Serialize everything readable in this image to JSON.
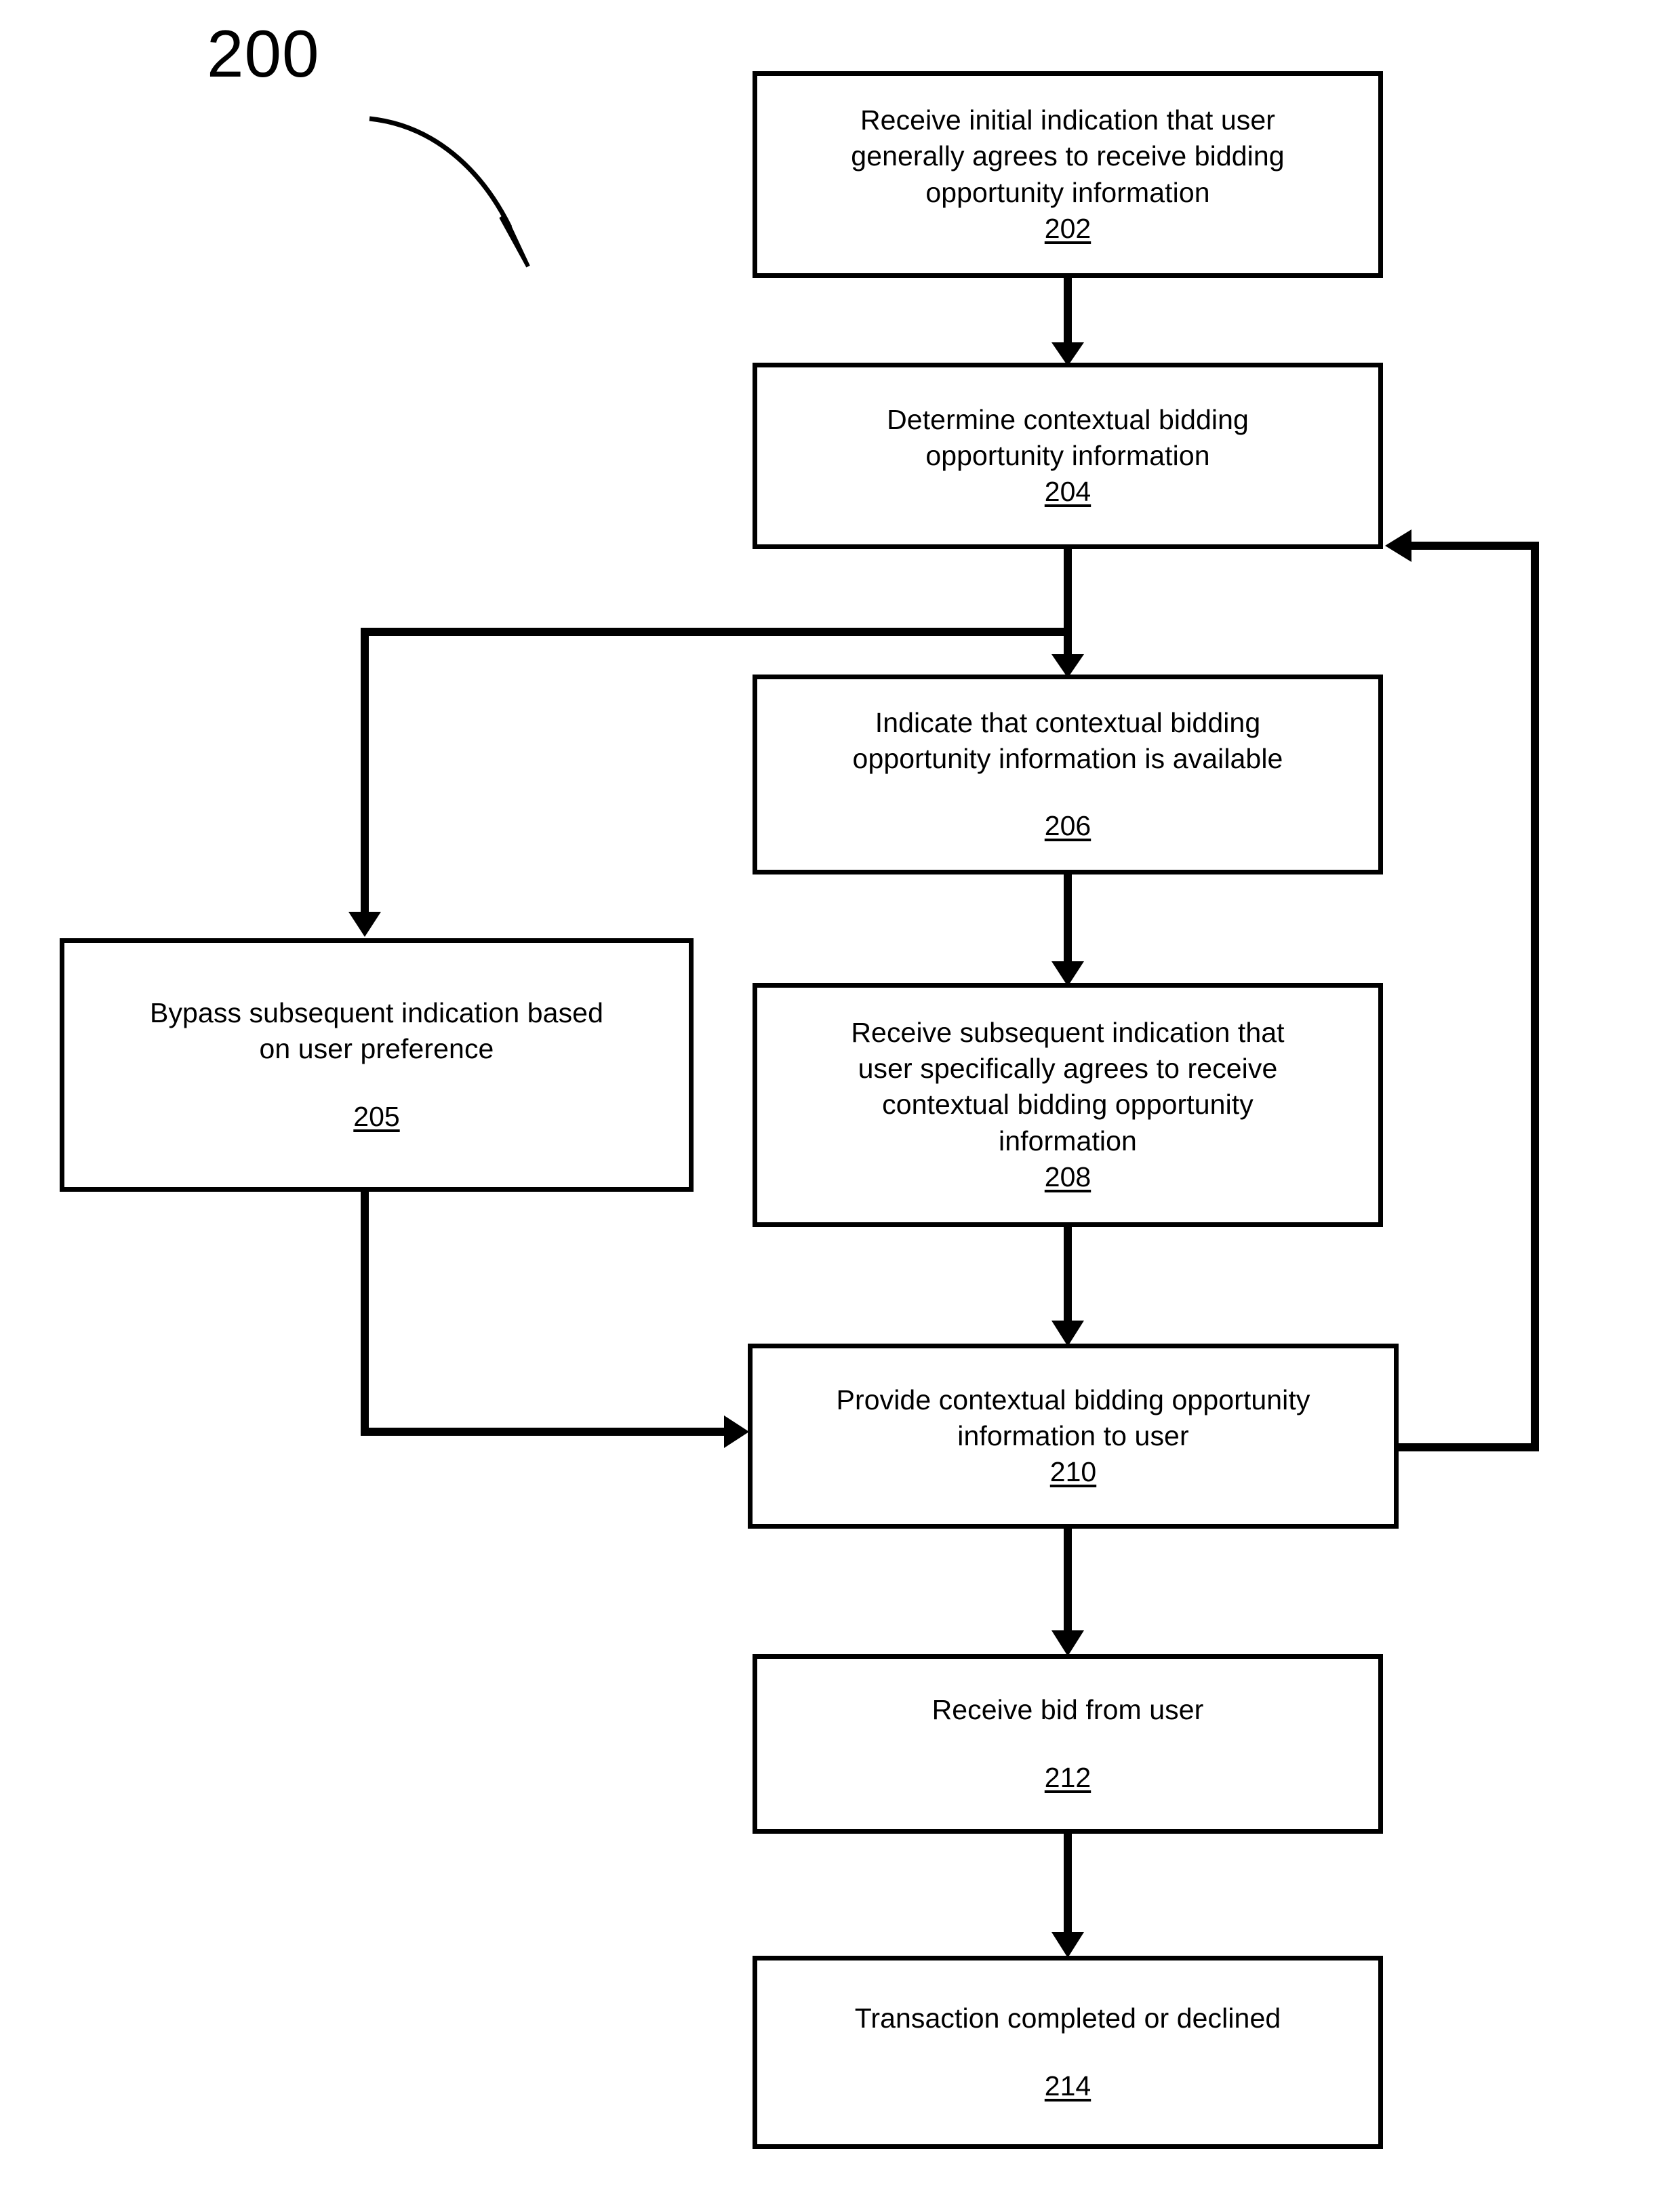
{
  "figure": {
    "number": "200",
    "pointer_icon": "curved-arrow-icon"
  },
  "nodes": [
    {
      "id": "202",
      "name": "receive-initial-indication",
      "label": "Receive initial indication that user\ngenerally agrees to receive bidding\nopportunity information",
      "ref": "202",
      "gap_before_ref": false
    },
    {
      "id": "204",
      "name": "determine-contextual-bidding-opportunity-information",
      "label": "Determine contextual bidding\nopportunity information",
      "ref": "204",
      "gap_before_ref": false
    },
    {
      "id": "206",
      "name": "indicate-information-available",
      "label": "Indicate that contextual bidding\nopportunity information is available",
      "ref": "206",
      "gap_before_ref": true
    },
    {
      "id": "205",
      "name": "bypass-subsequent-indication",
      "label": "Bypass subsequent indication based\non user preference",
      "ref": "205",
      "gap_before_ref": true
    },
    {
      "id": "208",
      "name": "receive-subsequent-indication",
      "label": "Receive subsequent indication that\nuser specifically agrees to receive\ncontextual bidding opportunity\ninformation",
      "ref": "208",
      "gap_before_ref": false
    },
    {
      "id": "210",
      "name": "provide-contextual-bidding-opportunity-information",
      "label": "Provide contextual bidding opportunity\ninformation to user",
      "ref": "210",
      "gap_before_ref": false
    },
    {
      "id": "212",
      "name": "receive-bid-from-user",
      "label": "Receive bid from user",
      "ref": "212",
      "gap_before_ref": true
    },
    {
      "id": "214",
      "name": "transaction-completed-or-declined",
      "label": "Transaction completed or declined",
      "ref": "214",
      "gap_before_ref": true
    }
  ],
  "connectors": [
    {
      "name": "edge-202-to-204",
      "from": "202",
      "to": "204",
      "kind": "arrow-down"
    },
    {
      "name": "edge-204-to-206",
      "from": "204",
      "to": "206",
      "kind": "arrow-down"
    },
    {
      "name": "edge-204-to-205",
      "from": "204",
      "to": "205",
      "kind": "branch-left-down-arrow"
    },
    {
      "name": "edge-206-to-208",
      "from": "206",
      "to": "208",
      "kind": "arrow-down"
    },
    {
      "name": "edge-208-to-210",
      "from": "208",
      "to": "210",
      "kind": "arrow-down"
    },
    {
      "name": "edge-205-to-210",
      "from": "205",
      "to": "210",
      "kind": "down-right-arrow"
    },
    {
      "name": "edge-210-to-212",
      "from": "210",
      "to": "212",
      "kind": "arrow-down"
    },
    {
      "name": "edge-212-to-214",
      "from": "212",
      "to": "214",
      "kind": "arrow-down"
    },
    {
      "name": "feedback-edge-210-to-204",
      "from": "210",
      "to": "204",
      "kind": "right-up-left-arrow"
    }
  ],
  "colors": {
    "stroke": "#000000",
    "fill": "#ffffff",
    "text": "#000000"
  }
}
